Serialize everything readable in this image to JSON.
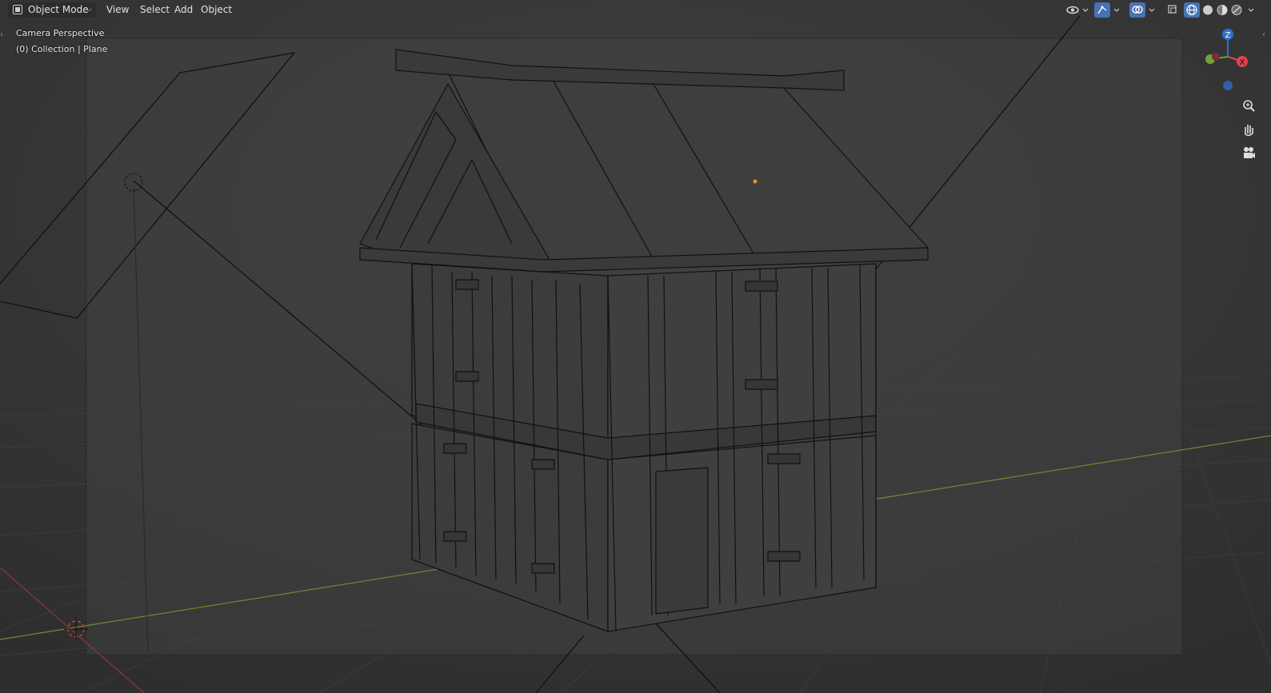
{
  "header": {
    "mode_label": "Object Mode",
    "menu": [
      "View",
      "Select",
      "Add",
      "Object"
    ]
  },
  "overlay": {
    "camera_label": "Camera Perspective",
    "collection_label": "(0) Collection | Plane"
  },
  "gizmo": {
    "z": "Z",
    "x": "X",
    "colors": {
      "z": "#2f6fd1",
      "x": "#e0414f",
      "y": "#6ea43a"
    }
  },
  "icons": {
    "mode": "object-mode-icon",
    "visibility": "eye-visibility-icon",
    "gizmo": "gizmo-toggle-icon",
    "overlay": "overlay-icon",
    "xray": "xray-icon",
    "shading": [
      "wireframe-shading-icon",
      "solid-shading-icon",
      "material-shading-icon",
      "rendered-shading-icon"
    ],
    "nav": [
      "zoom-icon",
      "pan-hand-icon",
      "camera-view-icon"
    ]
  },
  "colors": {
    "background": "#393939",
    "frame": "#444444",
    "wire": "#111111",
    "accent": "#4772b3",
    "x_axis": "#8a3a3a",
    "y_axis": "#6f8b32"
  }
}
